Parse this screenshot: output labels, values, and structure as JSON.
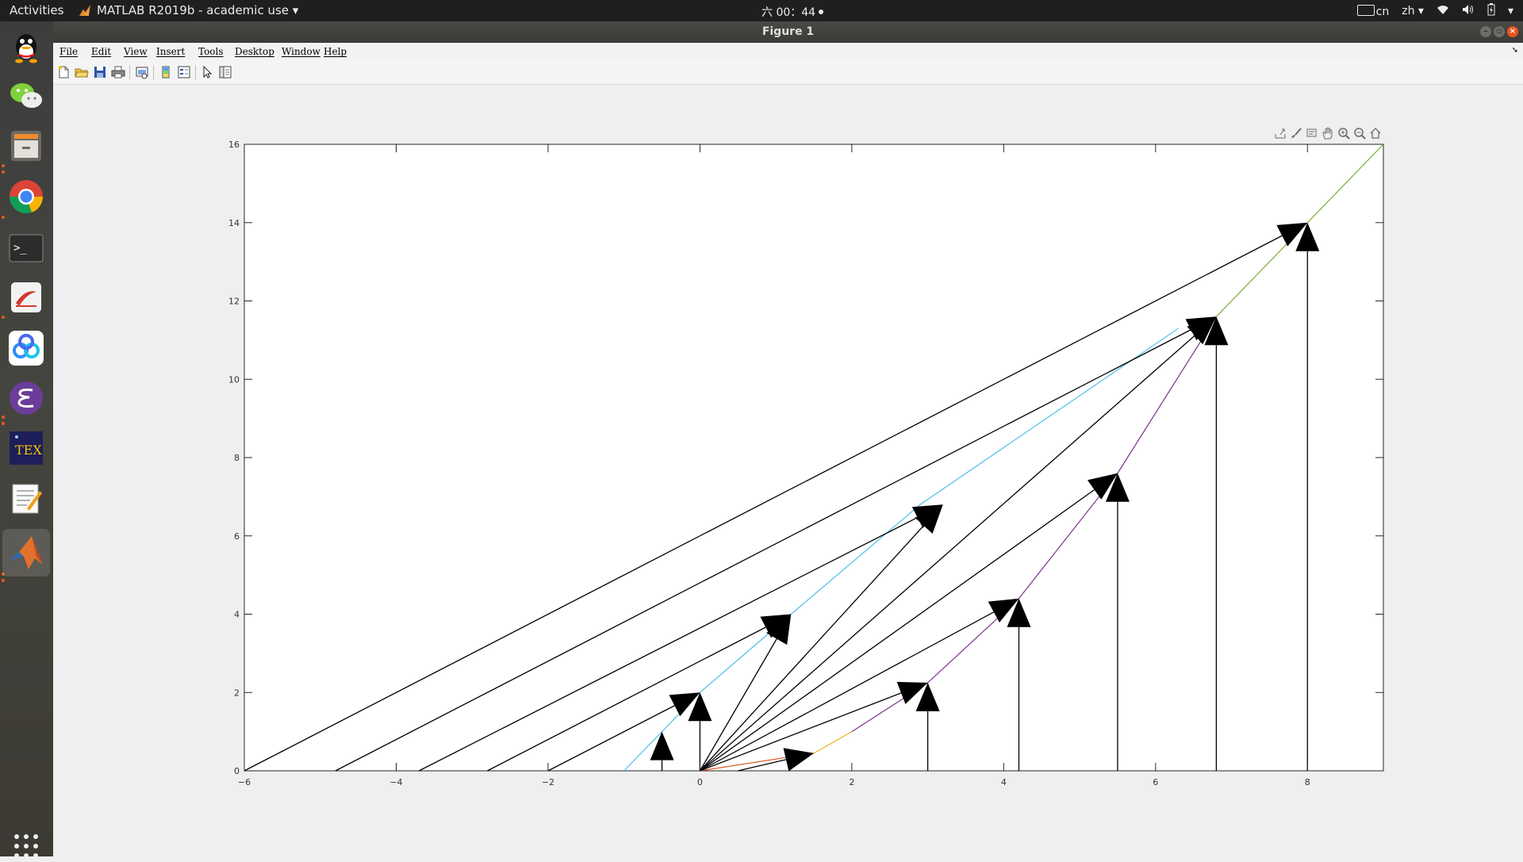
{
  "topbar": {
    "activities": "Activities",
    "app_name": "MATLAB R2019b - academic use",
    "clock": "六 00：44",
    "keyboard": "cn",
    "language": "zh"
  },
  "window": {
    "title": "Figure 1"
  },
  "menu": {
    "items": [
      "File",
      "Edit",
      "View",
      "Insert",
      "Tools",
      "Desktop",
      "Window",
      "Help"
    ]
  },
  "toolbar": {
    "buttons": [
      "new-figure",
      "open-file",
      "save",
      "print",
      "link-plot",
      "colorbar",
      "legend",
      "edit-plot",
      "property-inspector"
    ]
  },
  "axes_toolbar": {
    "buttons": [
      "export",
      "brush",
      "data-tips",
      "pan",
      "zoom-in",
      "zoom-out",
      "restore-view"
    ]
  },
  "dock": {
    "apps": [
      "QQ",
      "WeChat",
      "Files",
      "Chrome",
      "Terminal",
      "Document Viewer",
      "Baidu Netdisk",
      "Emacs",
      "TeX",
      "Text Editor",
      "MATLAB",
      "Show Applications"
    ]
  },
  "chart_data": {
    "type": "line",
    "xlim": [
      -6,
      9
    ],
    "ylim": [
      0,
      16
    ],
    "xticks": [
      -6,
      -4,
      -2,
      0,
      2,
      4,
      6,
      8
    ],
    "yticks": [
      0,
      2,
      4,
      6,
      8,
      10,
      12,
      14,
      16
    ],
    "grid": false,
    "series": [
      {
        "color": "#4dbeee",
        "points": [
          [
            -1,
            0
          ],
          [
            0,
            2
          ],
          [
            1.2,
            4
          ],
          [
            2.9,
            6.8
          ],
          [
            6.3,
            11.3
          ]
        ]
      },
      {
        "color": "#d95319",
        "points": [
          [
            0,
            0
          ],
          [
            1.5,
            0.45
          ]
        ]
      },
      {
        "color": "#edb120",
        "points": [
          [
            1.5,
            0.45
          ],
          [
            2,
            1
          ]
        ]
      },
      {
        "color": "#7e2f8e",
        "points": [
          [
            2,
            1
          ],
          [
            3,
            2.25
          ],
          [
            4.2,
            4.4
          ],
          [
            5.5,
            7.6
          ],
          [
            6.8,
            11.6
          ]
        ]
      },
      {
        "color": "#77ac30",
        "points": [
          [
            6.8,
            11.6
          ],
          [
            8,
            14
          ],
          [
            9,
            16
          ]
        ]
      }
    ],
    "arrows": [
      {
        "from": [
          -6,
          0
        ],
        "to": [
          8,
          14
        ]
      },
      {
        "from": [
          -4.8,
          0
        ],
        "to": [
          6.8,
          11.6
        ]
      },
      {
        "from": [
          -3.7,
          0
        ],
        "to": [
          3.2,
          6.8
        ]
      },
      {
        "from": [
          -2.8,
          0
        ],
        "to": [
          1.2,
          4
        ]
      },
      {
        "from": [
          -2,
          0
        ],
        "to": [
          0,
          2
        ]
      },
      {
        "from": [
          0,
          0
        ],
        "to": [
          1.2,
          4
        ]
      },
      {
        "from": [
          0,
          0
        ],
        "to": [
          3.2,
          6.8
        ]
      },
      {
        "from": [
          0,
          0
        ],
        "to": [
          6.8,
          11.6
        ]
      },
      {
        "from": [
          0,
          0
        ],
        "to": [
          5.5,
          7.6
        ]
      },
      {
        "from": [
          0,
          0
        ],
        "to": [
          4.2,
          4.4
        ]
      },
      {
        "from": [
          0,
          0
        ],
        "to": [
          3,
          2.25
        ]
      },
      {
        "from": [
          0.5,
          0
        ],
        "to": [
          1.5,
          0.45
        ]
      },
      {
        "from": [
          -0.5,
          0
        ],
        "to": [
          -0.5,
          1
        ]
      },
      {
        "from": [
          0,
          0
        ],
        "to": [
          0,
          2
        ]
      },
      {
        "from": [
          3,
          0
        ],
        "to": [
          3,
          2.25
        ]
      },
      {
        "from": [
          4.2,
          0
        ],
        "to": [
          4.2,
          4.4
        ]
      },
      {
        "from": [
          5.5,
          0
        ],
        "to": [
          5.5,
          7.6
        ]
      },
      {
        "from": [
          6.8,
          0
        ],
        "to": [
          6.8,
          11.6
        ]
      },
      {
        "from": [
          8,
          0
        ],
        "to": [
          8,
          14
        ]
      }
    ]
  }
}
